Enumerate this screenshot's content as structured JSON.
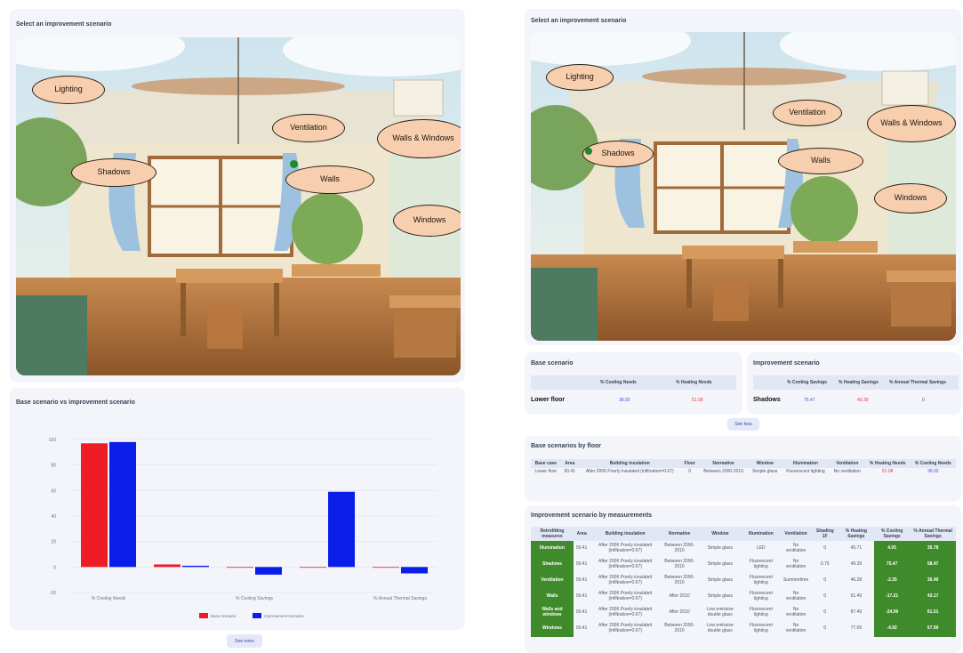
{
  "left": {
    "scenario_title": "Select an improvement scenario",
    "bubbles": {
      "lighting": "Lighting",
      "ventilation": "Ventilation",
      "walls_windows": "Walls & Windows",
      "shadows": "Shadows",
      "walls": "Walls",
      "windows": "Windows"
    },
    "chart_title": "Base scenario vs improvement scenario",
    "see_more": "See more"
  },
  "right": {
    "scenario_title": "Select an improvement scenario",
    "bubbles": {
      "lighting": "Lighting",
      "ventilation": "Ventilation",
      "walls_windows": "Walls & Windows",
      "shadows": "Shadows",
      "walls": "Walls",
      "windows": "Windows"
    },
    "base": {
      "title": "Base scenario",
      "headers": [
        "% Cooling Needs",
        "% Heating Needs"
      ],
      "row_label": "Lower floor",
      "cooling": "38.92",
      "heating": "51.08"
    },
    "improvement": {
      "title": "Improvement scenario",
      "headers": [
        "% Cooling Savings",
        "% Heating Savings",
        "% Annual Thermal Savings"
      ],
      "row_label": "Shadows",
      "cooling": "75.47",
      "heating": "49.39",
      "annual": "0"
    },
    "see_less": "See less",
    "by_floor": {
      "title": "Base scenarios by floor",
      "headers": [
        "Base case",
        "Area",
        "Building insulation",
        "Floor",
        "Normative",
        "Window",
        "Illumination",
        "Ventilation",
        "% Heating Needs",
        "% Cooling Needs"
      ],
      "row": [
        "Lower floor",
        "50.41",
        "After 2006 Poorly insulated (infiltration=0.67)",
        "0",
        "Between 2000-2010",
        "Simple glass",
        "Fluorescent lighting",
        "No ventilation",
        "51.08",
        "38.92"
      ]
    },
    "by_measurements": {
      "title": "Improvement scenario by measurements",
      "headers": [
        "Retrofitting measures",
        "Area",
        "Building insulation",
        "Normative",
        "Window",
        "Illumination",
        "Ventilation",
        "Shading 1F",
        "% Heating Savings",
        "% Cooling Savings",
        "% Annual Thermal Savings"
      ],
      "rows": [
        [
          "Illumination",
          "50.41",
          "After 2006 Poorly insulated (infiltration=0.67)",
          "Between 2000-2010",
          "Simple glass",
          "LED",
          "No ventilation",
          "0",
          "45.71",
          "4.05",
          "35.78"
        ],
        [
          "Shadows",
          "50.41",
          "After 2006 Poorly insulated (infiltration=0.67)",
          "Between 2000-2010",
          "Simple glass",
          "Fluorescent lighting",
          "No ventilation",
          "0.75",
          "49.39",
          "75.47",
          "58.47"
        ],
        [
          "Ventilation",
          "50.41",
          "After 2006 Poorly insulated (infiltration=0.67)",
          "Between 2000-2010",
          "Simple glass",
          "Fluorescent lighting",
          "Summertime",
          "0",
          "46.28",
          "-2.35",
          "36.49"
        ],
        [
          "Walls",
          "50.41",
          "After 2006 Poorly insulated (infiltration=0.67)",
          "After 2010",
          "Simple glass",
          "Fluorescent lighting",
          "No ventilation",
          "0",
          "61.49",
          "-17.21",
          "43.17"
        ],
        [
          "Walls and windows",
          "50.41",
          "After 2006 Poorly insulated (infiltration=0.67)",
          "After 2010",
          "Low emissive double glass",
          "Fluorescent lighting",
          "No ventilation",
          "0",
          "87.49",
          "-24.09",
          "61.51"
        ],
        [
          "Windows",
          "50.41",
          "After 2006 Poorly insulated (infiltration=0.67)",
          "Between 2000-2010",
          "Low emissive double glass",
          "Fluorescent lighting",
          "No ventilation",
          "0",
          "77.09",
          "-4.92",
          "57.99"
        ]
      ]
    }
  },
  "chart_data": {
    "type": "bar",
    "title": "Base scenario vs improvement scenario",
    "categories": [
      "% Cooling Needs",
      "% Heating Needs",
      "% Cooling Savings",
      "% Heating Savings",
      "% Annual Thermal Savings"
    ],
    "category_labels_shown": [
      "% Cooling Needs",
      "",
      "% Cooling Savings",
      "",
      "% Annual Thermal Savings"
    ],
    "series": [
      {
        "name": "Base scenario",
        "color": "#ee1c25",
        "values": [
          97,
          2,
          0,
          0,
          0
        ]
      },
      {
        "name": "Improvement scenario",
        "color": "#0b1de8",
        "values": [
          98,
          1,
          -6,
          59,
          -5
        ]
      }
    ],
    "yticks": [
      100,
      80,
      60,
      40,
      20,
      0,
      -20
    ],
    "ylim": [
      -20,
      100
    ],
    "grid": true,
    "legend_position": "bottom"
  }
}
